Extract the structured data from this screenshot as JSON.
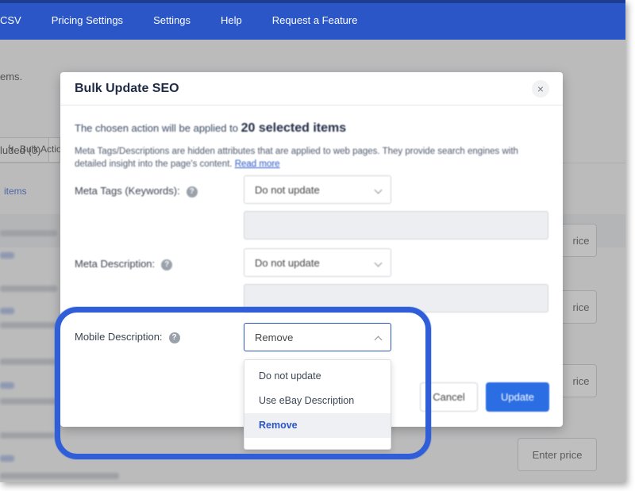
{
  "nav": {
    "items": [
      "CSV",
      "Pricing Settings",
      "Settings",
      "Help",
      "Request a Feature"
    ]
  },
  "background": {
    "items_text": "ems.",
    "tab_excluded": "luded (0)",
    "bulk_actions": "Bulk Actio",
    "selected_items": "items",
    "enter_price_labels": [
      "rice",
      "rice",
      "rice",
      "Enter price"
    ]
  },
  "modal": {
    "title": "Bulk Update SEO",
    "close_glyph": "×",
    "intro_text": "The chosen action will be applied to",
    "intro_count": "20 selected items",
    "help_text": "Meta Tags/Descriptions are hidden attributes that are applied to web pages. They provide search engines with detailed insight into the page's content.",
    "read_more": "Read more",
    "fields": {
      "meta_tags": {
        "label": "Meta Tags (Keywords):",
        "value": "Do not update"
      },
      "meta_description": {
        "label": "Meta Description:",
        "value": "Do not update"
      },
      "mobile_description": {
        "label": "Mobile Description:",
        "value": "Remove"
      }
    },
    "help_glyph": "?",
    "dropdown_options": [
      "Do not update",
      "Use eBay Description",
      "Remove"
    ],
    "selected_option": "Remove",
    "buttons": {
      "cancel": "Cancel",
      "update": "Update"
    }
  },
  "colors": {
    "nav_bg": "#2b56c7",
    "primary": "#2b6de3",
    "highlight": "#2f5ed8"
  }
}
